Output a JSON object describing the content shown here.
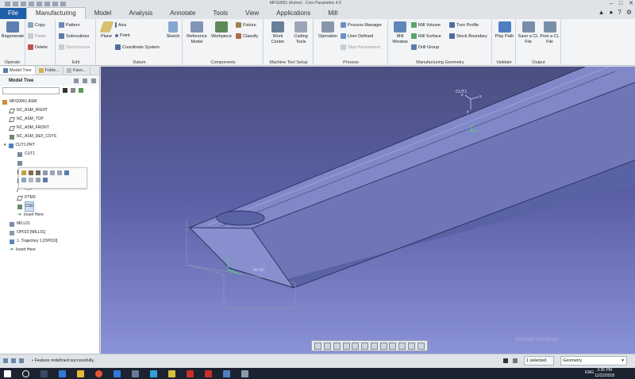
{
  "window": {
    "title": "MFG0001 (Active) - Creo Parametric 4.0"
  },
  "tabs": [
    "File",
    "Manufacturing",
    "Model",
    "Analysis",
    "Annotate",
    "Tools",
    "View",
    "Applications",
    "Mill"
  ],
  "ribbon": {
    "operate": {
      "label": "Operate",
      "regenerate": "Regenerate",
      "copy": "Copy",
      "paste": "Paste",
      "delete": "Delete"
    },
    "edit": {
      "label": "Edit",
      "pattern": "Pattern",
      "subroutines": "Subroutines",
      "synchronize": "Synchronize"
    },
    "datum": {
      "label": "Datum",
      "plane": "Plane",
      "axis": "Axis",
      "point": "Point",
      "coord": "Coordinate System",
      "sketch": "Sketch"
    },
    "components": {
      "label": "Components",
      "reference_model": "Reference Model",
      "workpiece": "Workpiece",
      "fixture": "Fixture",
      "classify": "Classify"
    },
    "mts": {
      "label": "Machine Tool Setup",
      "work_center": "Work Center",
      "cutting_tools": "Cutting Tools"
    },
    "process": {
      "label": "Process",
      "operation": "Operation",
      "manager": "Process Manager",
      "user_defined": "User Defined",
      "step_params": "Step Parameters"
    },
    "mfg_geom": {
      "label": "Manufacturing Geometry",
      "mill_window": "Mill Window",
      "mill_volume": "Mill Volume",
      "mill_surface": "Mill Surface",
      "drill_group": "Drill Group",
      "turn_profile": "Turn Profile",
      "stock_boundary": "Stock Boundary"
    },
    "validate": {
      "label": "Validate",
      "play_path": "Play Path"
    },
    "output": {
      "label": "Output",
      "save_cl": "Save a CL File",
      "post_cl": "Post a CL File"
    }
  },
  "left_panel": {
    "tabs": [
      "Model Tree",
      "Folde...",
      "Favo..."
    ],
    "header": "Model Tree",
    "tree": [
      {
        "label": "MFG0001.ASM",
        "indent": 0
      },
      {
        "label": "NC_ASM_RIGHT",
        "indent": 1
      },
      {
        "label": "NC_ASM_TOP",
        "indent": 1
      },
      {
        "label": "NC_ASM_FRONT",
        "indent": 1
      },
      {
        "label": "NC_ASM_DEF_CSYS",
        "indent": 1
      },
      {
        "label": "CUT1.PRT",
        "indent": 1
      },
      {
        "label": "CUT1",
        "indent": 2
      },
      {
        "label": "",
        "indent": 2
      },
      {
        "label": "",
        "indent": 2
      },
      {
        "label": "",
        "indent": 2
      },
      {
        "label": "A_1",
        "indent": 2
      },
      {
        "label": "DTM3",
        "indent": 2
      },
      {
        "label": "CS0",
        "indent": 2
      },
      {
        "label": "Insert Here",
        "indent": 2
      },
      {
        "label": "MILL01",
        "indent": 1
      },
      {
        "label": "OP010 [MILL01]",
        "indent": 1
      },
      {
        "label": "1. Trajectory 1 [OP010]",
        "indent": 1
      },
      {
        "label": "Insert Here",
        "indent": 1
      }
    ]
  },
  "viewport": {
    "labels": {
      "cut1": "CUT1",
      "x": "x",
      "y": "y",
      "z": "z",
      "acs0": "ACS0",
      "watermark": "Activate Windows"
    }
  },
  "status": {
    "message": "Feature redefined successfully.",
    "selected": "1 selected",
    "filter": "Geometry"
  },
  "taskbar": {
    "lang": "ENG",
    "time": "3:35 PM",
    "date": "11/22/2018"
  },
  "colors": {
    "file_tab": "#1f5fa8",
    "viewport_top": "#4a4f80",
    "viewport_bottom": "#8a92d8",
    "part_face": "#7c84c6",
    "part_edge": "#2e3560"
  }
}
